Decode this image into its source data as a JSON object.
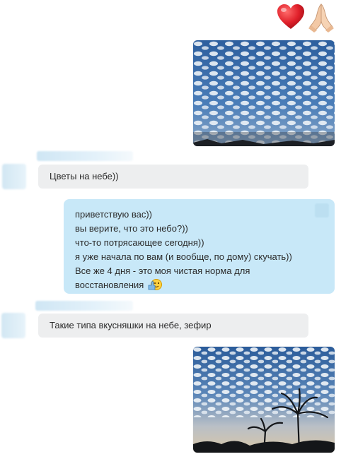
{
  "reactions": [
    {
      "icon": "red-heart-icon",
      "glyph": "❤"
    },
    {
      "icon": "folded-hands-icon",
      "glyph": "🙏"
    }
  ],
  "messages": {
    "incoming_1": "Цветы на небе))",
    "outgoing_lines": [
      "приветствую вас))",
      "вы верите, что это небо?))",
      "что-то потрясающее сегодня))",
      "я уже начала по вам (и вообще, по дому) скучать))",
      "Все же 4 дня - это моя чистая норма для",
      "восстановления"
    ],
    "incoming_2": "Такие типа вкусняшки на небе, зефир"
  },
  "colors": {
    "incoming_bubble": "#edeeef",
    "outgoing_bubble": "#c8e8f8",
    "sky": "#3e6ea8"
  }
}
